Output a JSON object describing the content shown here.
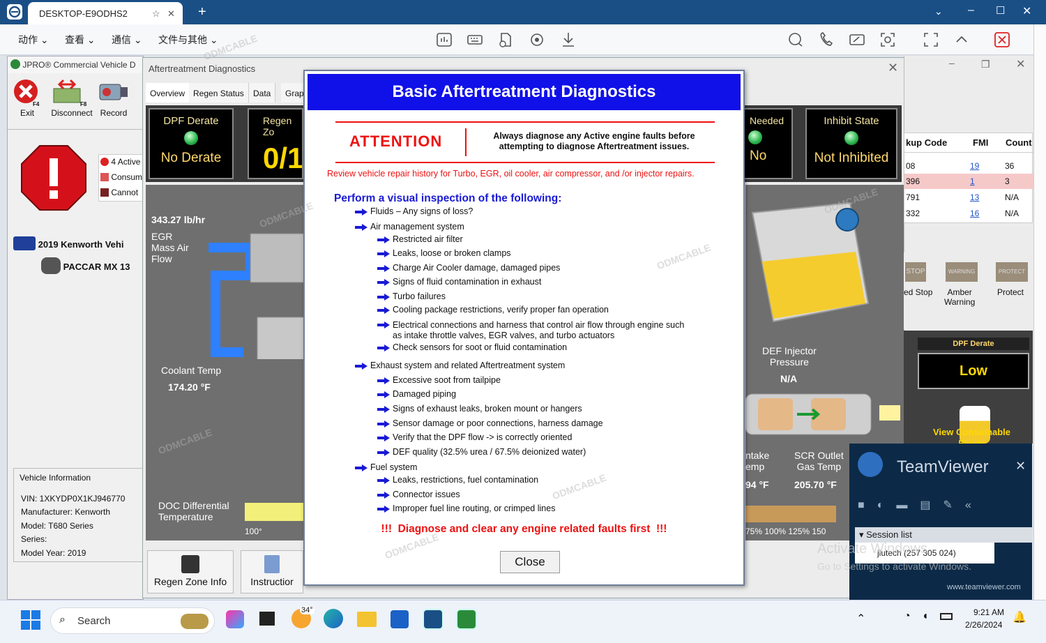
{
  "browser": {
    "tab_title": "DESKTOP-E9ODHS2",
    "new_tab": "+",
    "menus": [
      "动作",
      "查看",
      "通信",
      "文件与其他"
    ]
  },
  "jpro": {
    "title": "JPRO® Commercial Vehicle D",
    "toolbar": {
      "exit": "Exit",
      "exit_key": "F4",
      "disconnect": "Disconnect",
      "disconnect_key": "F8",
      "record": "Record"
    },
    "alerts": [
      "4 Active",
      "Consum",
      "Cannot"
    ],
    "vehicle_name": "2019 Kenworth  Vehi",
    "engine_name": "PACCAR MX 13",
    "vehicle_info_title": "Vehicle Information",
    "vin": "VIN: 1XKYDP0X1KJ946770",
    "manufacturer": "Manufacturer: Kenworth",
    "model": "Model: T680 Series",
    "series": "Series:",
    "model_year": "Model Year: 2019"
  },
  "aftertreatment": {
    "title": "Aftertreatment Diagnostics",
    "tabs": [
      "Overview",
      "Regen Status",
      "Data",
      "Grapl"
    ],
    "dpf_derate_label": "DPF Derate",
    "dpf_derate_value": "No Derate",
    "regen_label": "Regen Zo",
    "regen_value": "0/1",
    "needed_label": "Needed",
    "needed_value": "No",
    "inhibit_label": "Inhibit State",
    "inhibit_value": "Not Inhibited",
    "mass_air_value": "343.27 lb/hr",
    "mass_air_label": "EGR\nMass Air\nFlow",
    "coolant_label": "Coolant Temp",
    "coolant_value": "174.20 °F",
    "doc_label": "DOC Differential\nTemperature",
    "doc_scale": "100°",
    "def_injector_label": "DEF Injector\nPressure",
    "def_injector_value": "N/A",
    "intake_label": "ntake\nemp",
    "intake_value": "94 °F",
    "scr_label": "SCR Outlet\nGas Temp",
    "scr_value": "205.70 °F",
    "scale_labels": "75% 100% 125% 150",
    "regen_zone_btn": "Regen Zone Info",
    "instructions_btn": "Instructior",
    "fault_table": {
      "headers": [
        "kup Code",
        "FMI",
        "Count"
      ],
      "rows": [
        [
          "08",
          "19",
          "36"
        ],
        [
          "396",
          "1",
          "3"
        ],
        [
          "791",
          "13",
          "N/A"
        ],
        [
          "332",
          "16",
          "N/A"
        ]
      ]
    },
    "lamps": [
      "STOP",
      "WARNING",
      "PROTECT"
    ],
    "lamp_labels": [
      "ed Stop",
      "Amber\nWarning",
      "Protect"
    ],
    "dpf_derate_panel": "DPF Derate",
    "dpf_derate_level": "Low",
    "view_consumable": "View Consumable\nFluids"
  },
  "modal": {
    "title": "Basic Aftertreatment Diagnostics",
    "attention": "ATTENTION",
    "attention_text": "Always diagnose any Active engine faults before\nattempting to diagnose Aftertreatment issues.",
    "review": "Review vehicle repair history for Turbo, EGR, oil cooler, air compressor, and /or injector repairs.",
    "inspect_title": "Perform a visual inspection of the following:",
    "sections": [
      {
        "label": "Fluids – Any signs of loss?",
        "items": []
      },
      {
        "label": "Air management system",
        "items": [
          "Restricted air filter",
          "Leaks, loose or broken clamps",
          "Charge Air Cooler damage, damaged pipes",
          "Signs of fluid contamination in exhaust",
          "Turbo failures",
          "Cooling package restrictions, verify proper fan operation",
          "Electrical connections and harness that control air flow through engine such\nas intake throttle valves, EGR valves, and turbo actuators",
          "Check sensors for soot or fluid contamination"
        ]
      },
      {
        "label": "Exhaust system and related Aftertreatment system",
        "items": [
          "Excessive soot from tailpipe",
          "Damaged piping",
          "Signs of exhaust leaks, broken mount or hangers",
          "Sensor damage or poor connections, harness damage",
          "Verify that the DPF flow -> is correctly oriented",
          "DEF quality (32.5% urea / 67.5% deionized water)"
        ]
      },
      {
        "label": "Fuel system",
        "items": [
          "Leaks, restrictions, fuel contamination",
          "Connector issues",
          "Improper fuel line routing, or crimped lines"
        ]
      }
    ],
    "footer_warning": "!!!  Diagnose and clear any engine related faults first  !!!",
    "close": "Close"
  },
  "teamviewer": {
    "title": "TeamViewer",
    "session_list": "Session list",
    "session_user": "jiutech (257 305 024)",
    "url": "www.teamviewer.com",
    "activate1": "Activate Windows",
    "activate2": "Go to Settings to activate Windows."
  },
  "taskbar": {
    "search": "Search",
    "weather": "34°",
    "time": "9:21 AM",
    "date": "2/26/2024"
  },
  "watermark": "ODMCABLE"
}
